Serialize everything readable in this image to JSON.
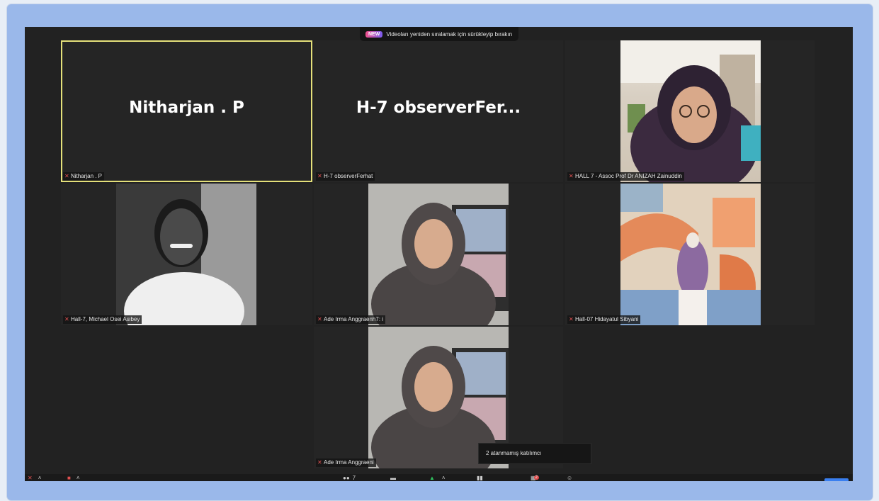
{
  "banner": {
    "badge": "NEW",
    "text": "Videoları yeniden sıralamak için sürükleyip bırakın"
  },
  "tiles": [
    {
      "display_name": "Nitharjan . P",
      "label": "Nitharjan . P"
    },
    {
      "display_name": "H-7  observerFer...",
      "label": "H-7 observerFerhat"
    },
    {
      "label": "HALL 7 - Assoc Prof Dr ANIZAH Zainuddin"
    },
    {
      "label": "Hall-7, Michael Osei Asibey"
    },
    {
      "label": "Ade Irma Anggraenh7: i"
    },
    {
      "label": "Hall-07 Hidayatul Sibyani"
    },
    {
      "label": "Ade Irma Anggraeni"
    }
  ],
  "tooltip": {
    "text": "2 atanmamış katılımcı"
  },
  "toolbar": {
    "participants_count": "7",
    "breakout_badge": "2"
  },
  "icons": [
    "mic-muted-icon",
    "video-off-icon",
    "participants-icon",
    "chat-icon",
    "share-screen-icon",
    "record-icon",
    "breakout-rooms-icon",
    "reactions-icon",
    "caret-up-icon"
  ],
  "colors": {
    "active_speaker_border": "#e4e07a",
    "screen_bg": "#222222",
    "frame": "#9ab8ea"
  }
}
